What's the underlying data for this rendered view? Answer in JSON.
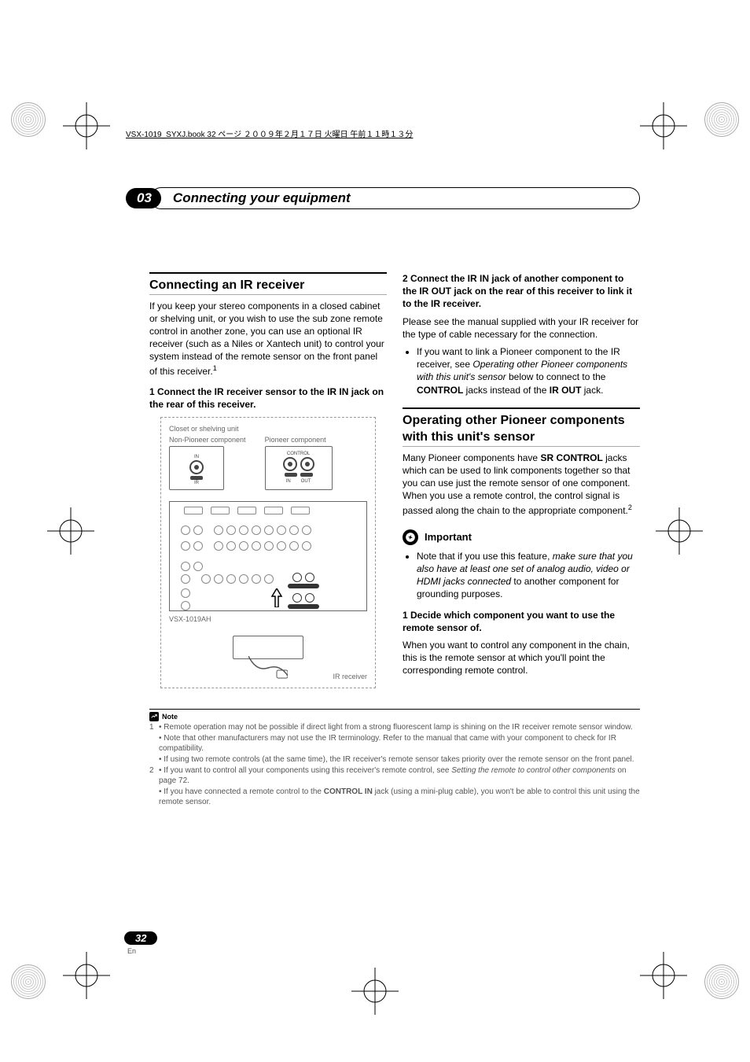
{
  "header": {
    "file_info": "VSX-1019_SYXJ.book 32 ページ ２００９年２月１７日 火曜日 午前１１時１３分"
  },
  "chapter": {
    "number": "03",
    "title": "Connecting your equipment"
  },
  "left": {
    "section_title": "Connecting an IR receiver",
    "intro": "If you keep your stereo components in a closed cabinet or shelving unit, or you wish to use the sub zone remote control in another zone, you can use an optional IR receiver (such as a Niles or Xantech unit) to control your system instead of the remote sensor on the front panel of this receiver.",
    "intro_sup": "1",
    "step1": "1   Connect the IR receiver sensor to the IR IN jack on the rear of this receiver.",
    "diag": {
      "closet": "Closet or shelving unit",
      "non_pioneer": "Non-Pioneer component",
      "pioneer": "Pioneer component",
      "control": "CONTROL",
      "in": "IN",
      "out": "OUT",
      "ir": "IR",
      "model": "VSX-1019AH",
      "ir_receiver": "IR receiver"
    }
  },
  "right": {
    "step2_title": "2   Connect the IR IN jack of another component to the IR OUT jack on the rear of this receiver to link it to the IR receiver.",
    "step2_body": "Please see the manual supplied with your IR receiver for the type of cable necessary for the connection.",
    "step2_bullet_pre": "If you want to link a Pioneer component to the IR receiver, see ",
    "step2_bullet_em": "Operating other Pioneer components with this unit's sensor",
    "step2_bullet_mid": " below to connect to the ",
    "step2_bullet_b1": "CONTROL",
    "step2_bullet_mid2": " jacks instead of the ",
    "step2_bullet_b2": "IR OUT",
    "step2_bullet_end": " jack.",
    "section2_title": "Operating other Pioneer components with this unit's sensor",
    "section2_intro_pre": "Many Pioneer components have ",
    "section2_intro_b": "SR CONTROL",
    "section2_intro_post": " jacks which can be used to link components together so that you can use just the remote sensor of one component. When you use a remote control, the control signal is passed along the chain to the appropriate component.",
    "section2_sup": "2",
    "important_label": "Important",
    "important_bullet_pre": "Note that if you use this feature, ",
    "important_bullet_em": "make sure that you also have at least one set of analog audio, video or HDMI jacks connected",
    "important_bullet_post": " to another component for grounding purposes.",
    "step1_title": "1   Decide which component you want to use the remote sensor of.",
    "step1_body": "When you want to control any component in the chain, this is the remote sensor at which you'll point the corresponding remote control."
  },
  "footnotes": {
    "note_label": "Note",
    "f1a": "• Remote operation may not be possible if direct light from a strong fluorescent lamp is shining on the IR receiver remote sensor window.",
    "f1b": "• Note that other manufacturers may not use the IR terminology. Refer to the manual that came with your component to check for IR compatibility.",
    "f1c": "• If using two remote controls (at the same time), the IR receiver's remote sensor takes priority over the remote sensor on the front panel.",
    "f2a_pre": "• If you want to control all your components using this receiver's remote control, see ",
    "f2a_em": "Setting the remote to control other components",
    "f2a_post": " on page 72.",
    "f2b_pre": "• If you have connected a remote control to the ",
    "f2b_b": "CONTROL IN",
    "f2b_post": " jack (using a mini-plug cable), you won't be able to control this unit using the remote sensor."
  },
  "page": {
    "number": "32",
    "lang": "En"
  }
}
